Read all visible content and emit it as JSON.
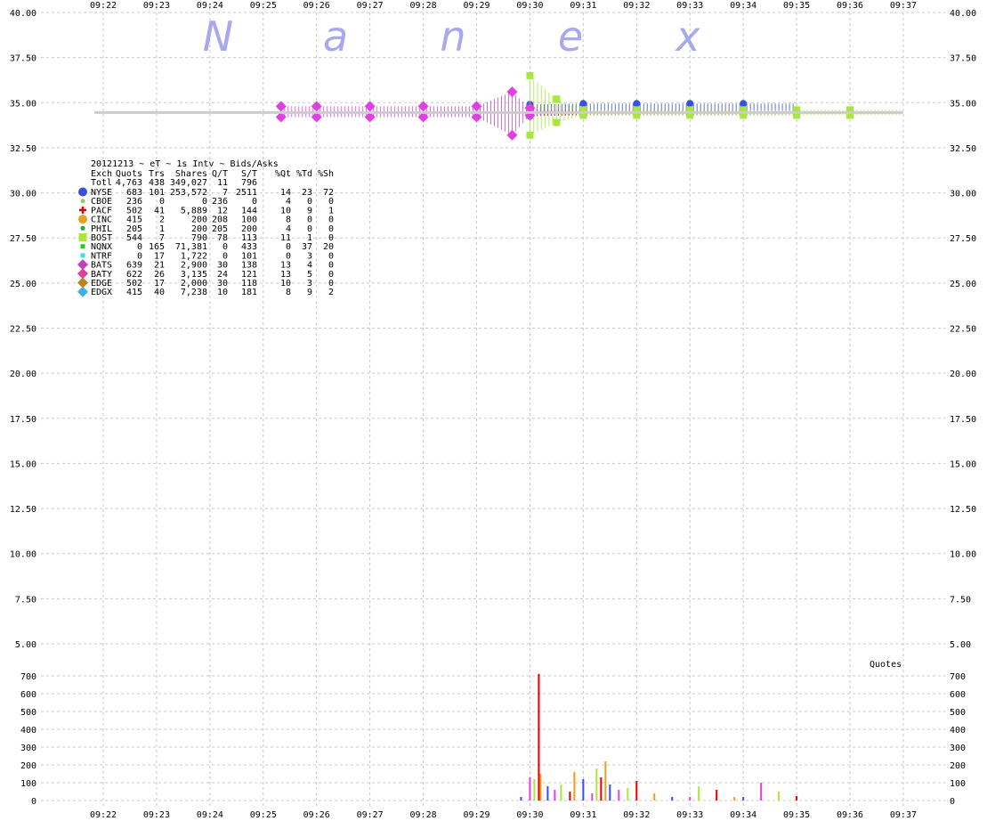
{
  "chart_data": [
    {
      "type": "line",
      "title": "20121213 ~ eT ~ 1s Intv ~ Bids/Asks",
      "watermark": [
        "N",
        "a",
        "n",
        "e",
        "x"
      ],
      "x_ticks": [
        "09:22",
        "09:23",
        "09:24",
        "09:25",
        "09:26",
        "09:27",
        "09:28",
        "09:29",
        "09:30",
        "09:31",
        "09:32",
        "09:33",
        "09:34",
        "09:35",
        "09:36",
        "09:37"
      ],
      "y_ticks": [
        "40.00",
        "37.50",
        "35.00",
        "32.50",
        "30.00",
        "27.50",
        "25.00",
        "22.50",
        "20.00",
        "17.50",
        "15.00",
        "12.50",
        "10.00",
        "7.50",
        "5.00"
      ],
      "ylim": [
        5,
        40
      ],
      "grid": true,
      "series": [
        {
          "name": "NYSE",
          "color": "#3a4fe0",
          "marker": "circle",
          "x": [
            "09:30",
            "09:31",
            "09:32",
            "09:33",
            "09:34",
            "09:35"
          ],
          "bid": [
            34.25,
            34.3,
            34.3,
            34.3,
            34.3,
            34.3
          ],
          "ask": [
            34.9,
            34.95,
            34.95,
            34.95,
            34.95,
            34.95
          ]
        },
        {
          "name": "PACF",
          "color": "#e00000",
          "marker": "plus",
          "x": [
            "09:30",
            "09:31",
            "09:32",
            "09:33",
            "09:34"
          ],
          "bid": [
            34.3,
            34.3,
            34.35,
            34.35,
            34.35
          ],
          "ask": [
            34.6,
            34.55,
            34.6,
            34.6,
            34.6
          ]
        },
        {
          "name": "BOST",
          "color": "#a8e83a",
          "marker": "square",
          "x": [
            "09:30",
            "09:30:30",
            "09:31",
            "09:32",
            "09:33",
            "09:34",
            "09:35",
            "09:36",
            "09:37"
          ],
          "bid": [
            33.2,
            33.9,
            34.3,
            34.3,
            34.3,
            34.3,
            34.3,
            34.3,
            34.3
          ],
          "ask": [
            36.5,
            35.2,
            34.6,
            34.6,
            34.6,
            34.6,
            34.6,
            34.6,
            34.6
          ]
        },
        {
          "name": "BATS",
          "color": "#e040e0",
          "marker": "diamond",
          "x": [
            "09:25:20",
            "09:26",
            "09:27",
            "09:28",
            "09:29",
            "09:29:40",
            "09:30",
            "09:31"
          ],
          "bid": [
            34.2,
            34.2,
            34.2,
            34.2,
            34.2,
            33.2,
            34.3,
            34.35
          ],
          "ask": [
            34.8,
            34.8,
            34.8,
            34.8,
            34.8,
            35.6,
            34.7,
            34.6
          ]
        },
        {
          "name": "NTRF",
          "color": "#cccccc",
          "marker": "line",
          "x": [
            "09:21:50",
            "09:30",
            "09:37"
          ],
          "bid": [
            34.45,
            34.45,
            34.45
          ],
          "ask": [
            34.45,
            34.45,
            34.45
          ]
        }
      ]
    },
    {
      "type": "bar",
      "title": "Quotes",
      "y_ticks": [
        "700",
        "600",
        "500",
        "400",
        "300",
        "200",
        "100",
        "0"
      ],
      "ylim": [
        0,
        750
      ],
      "series": [
        {
          "name": "Quotes",
          "x": [
            "09:29:50",
            "09:30:00",
            "09:30:05",
            "09:30:10",
            "09:30:12",
            "09:30:20",
            "09:30:28",
            "09:30:35",
            "09:30:45",
            "09:30:50",
            "09:31:00",
            "09:31:10",
            "09:31:15",
            "09:31:20",
            "09:31:25",
            "09:31:30",
            "09:31:40",
            "09:31:50",
            "09:32:00",
            "09:32:20",
            "09:32:40",
            "09:33:00",
            "09:33:10",
            "09:33:30",
            "09:33:50",
            "09:34:00",
            "09:34:20",
            "09:34:40",
            "09:35:00"
          ],
          "values": [
            20,
            130,
            120,
            710,
            150,
            80,
            60,
            90,
            50,
            160,
            120,
            40,
            180,
            130,
            220,
            90,
            60,
            70,
            110,
            40,
            20,
            20,
            80,
            60,
            20,
            20,
            100,
            50,
            25
          ]
        }
      ]
    }
  ],
  "stats_table": {
    "columns": [
      "Exch",
      "Quots",
      "Trs",
      "Shares",
      "Q/T",
      "S/T",
      "%Qt",
      "%Td",
      "%Sh"
    ],
    "total": [
      "Totl",
      "4,763",
      "438",
      "349,027",
      "11",
      "796",
      "",
      "",
      ""
    ],
    "rows": [
      {
        "exch": "NYSE",
        "color": "#3a4fe0",
        "marker": "circle",
        "values": [
          "683",
          "101",
          "253,572",
          "7",
          "2511",
          "14",
          "23",
          "72"
        ]
      },
      {
        "exch": "CBOE",
        "color": "#8fd05f",
        "marker": "dot",
        "values": [
          "236",
          "0",
          "0",
          "236",
          "0",
          "4",
          "0",
          "0"
        ]
      },
      {
        "exch": "PACF",
        "color": "#e00000",
        "marker": "plus",
        "values": [
          "502",
          "41",
          "5,889",
          "12",
          "144",
          "10",
          "9",
          "1"
        ]
      },
      {
        "exch": "CINC",
        "color": "#e8a020",
        "marker": "circle",
        "values": [
          "415",
          "2",
          "200",
          "208",
          "100",
          "8",
          "0",
          "0"
        ]
      },
      {
        "exch": "PHIL",
        "color": "#20b020",
        "marker": "dot",
        "values": [
          "205",
          "1",
          "200",
          "205",
          "200",
          "4",
          "0",
          "0"
        ]
      },
      {
        "exch": "BOST",
        "color": "#a8e83a",
        "marker": "square",
        "values": [
          "544",
          "7",
          "790",
          "78",
          "113",
          "11",
          "1",
          "0"
        ]
      },
      {
        "exch": "NQNX",
        "color": "#20d020",
        "marker": "smallsquare",
        "values": [
          "0",
          "165",
          "71,381",
          "0",
          "433",
          "0",
          "37",
          "20"
        ]
      },
      {
        "exch": "NTRF",
        "color": "#40e0e0",
        "marker": "smallsquare",
        "values": [
          "0",
          "17",
          "1,722",
          "0",
          "101",
          "0",
          "3",
          "0"
        ]
      },
      {
        "exch": "BATS",
        "color": "#c040c0",
        "marker": "diamond",
        "values": [
          "639",
          "21",
          "2,900",
          "30",
          "138",
          "13",
          "4",
          "0"
        ]
      },
      {
        "exch": "BATY",
        "color": "#e040a0",
        "marker": "diamond",
        "values": [
          "622",
          "26",
          "3,135",
          "24",
          "121",
          "13",
          "5",
          "0"
        ]
      },
      {
        "exch": "EDGE",
        "color": "#c08020",
        "marker": "diamond",
        "values": [
          "502",
          "17",
          "2,000",
          "30",
          "118",
          "10",
          "3",
          "0"
        ]
      },
      {
        "exch": "EDGX",
        "color": "#40b0e0",
        "marker": "diamond",
        "values": [
          "415",
          "40",
          "7,238",
          "10",
          "181",
          "8",
          "9",
          "2"
        ]
      }
    ]
  },
  "colors": {
    "grid": "#c8c8c8",
    "axis": "#888888"
  }
}
